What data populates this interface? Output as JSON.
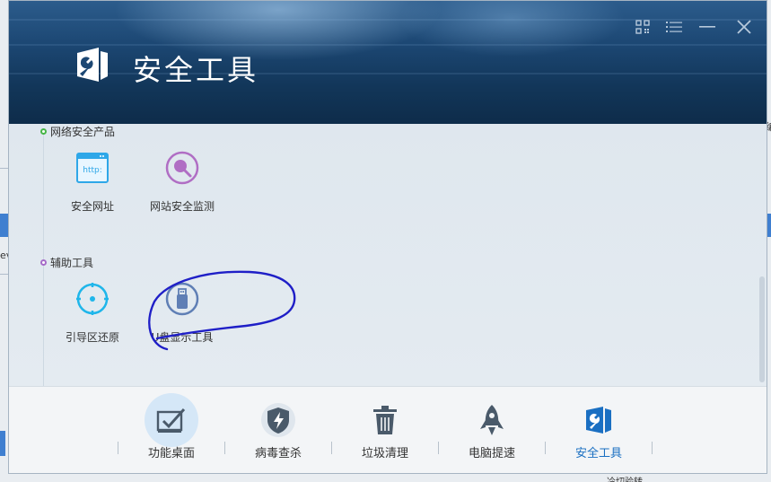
{
  "window": {
    "title": "安全工具",
    "accent": "#1a6fc2"
  },
  "controls": {
    "qr_icon": "qr-code-icon",
    "menu_icon": "menu-icon",
    "minimize_icon": "minimize-icon",
    "close_icon": "close-icon"
  },
  "sections": [
    {
      "title": "网络安全产品",
      "dot_color": "#46b646",
      "tools": [
        {
          "label": "安全网址",
          "icon": "browser-http-icon"
        },
        {
          "label": "网站安全监测",
          "icon": "magnifier-icon"
        }
      ]
    },
    {
      "title": "辅助工具",
      "dot_color": "#a66cc9",
      "tools": [
        {
          "label": "引导区还原",
          "icon": "crosshair-icon"
        },
        {
          "label": "U盘显示工具",
          "icon": "usb-drive-icon"
        }
      ]
    }
  ],
  "bottom_nav": [
    {
      "label": "功能桌面",
      "icon": "checked-board-icon"
    },
    {
      "label": "病毒查杀",
      "icon": "shield-bolt-icon"
    },
    {
      "label": "垃圾清理",
      "icon": "trash-icon"
    },
    {
      "label": "电脑提速",
      "icon": "rocket-icon"
    },
    {
      "label": "安全工具",
      "icon": "wrench-shield-icon"
    }
  ],
  "background": {
    "left_text": "ev",
    "right_text": "编",
    "bottom_text": "冷切验转"
  }
}
